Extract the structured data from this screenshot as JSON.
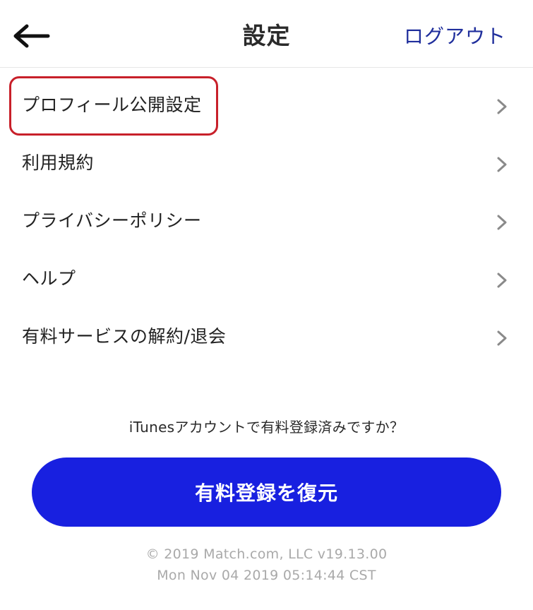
{
  "header": {
    "title": "設定",
    "logout_label": "ログアウト"
  },
  "menu": {
    "items": [
      {
        "label": "プロフィール公開設定"
      },
      {
        "label": "利用規約"
      },
      {
        "label": "プライバシーポリシー"
      },
      {
        "label": "ヘルプ"
      },
      {
        "label": "有料サービスの解約/退会"
      }
    ]
  },
  "restore": {
    "note": "iTunesアカウントで有料登録済みですか？",
    "button_label": "有料登録を復元"
  },
  "footer": {
    "copyright": "© 2019 Match.com, LLC v19.13.00",
    "timestamp": "Mon Nov 04 2019 05:14:44 CST"
  },
  "colors": {
    "accent_blue": "#1820e0",
    "logout_blue": "#1f2e9c",
    "highlight_red": "#c8202a"
  },
  "icons": {
    "back": "arrow-left-icon",
    "chevron": "chevron-right-icon"
  }
}
